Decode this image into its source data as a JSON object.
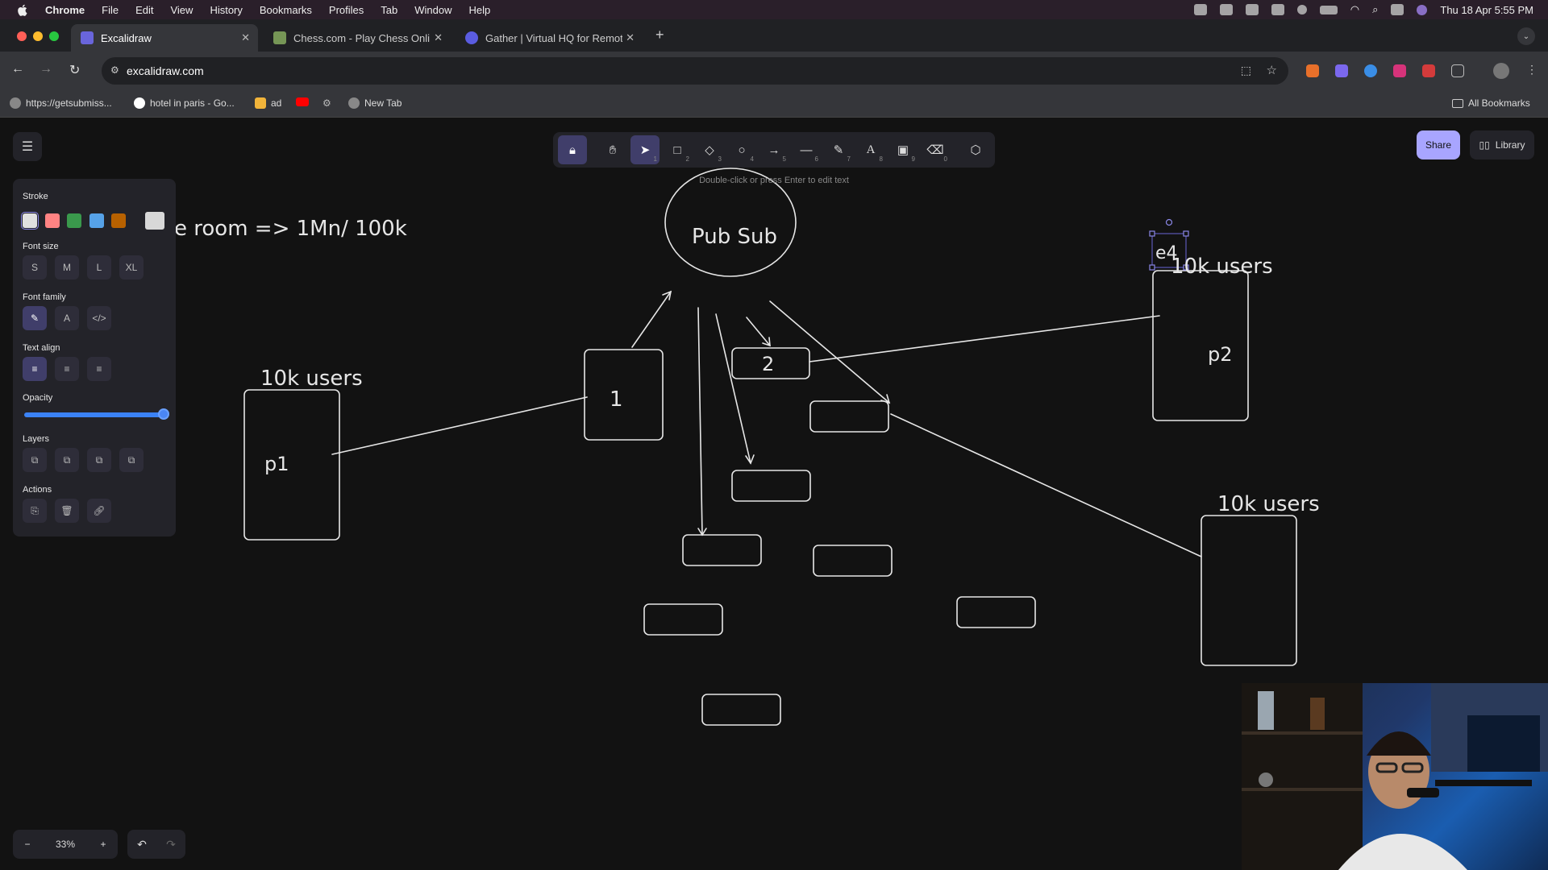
{
  "menubar": {
    "app": "Chrome",
    "items": [
      "File",
      "Edit",
      "View",
      "History",
      "Bookmarks",
      "Profiles",
      "Tab",
      "Window",
      "Help"
    ],
    "clock": "Thu 18 Apr  5:55 PM"
  },
  "tabs": [
    {
      "label": "Excalidraw",
      "icon": "excalidraw-icon",
      "active": true
    },
    {
      "label": "Chess.com - Play Chess Onli",
      "icon": "chess-icon",
      "active": false
    },
    {
      "label": "Gather | Virtual HQ for Remot",
      "icon": "gather-icon",
      "active": false
    }
  ],
  "address": {
    "url": "excalidraw.com"
  },
  "bookmarks": {
    "items": [
      "https://getsubmiss...",
      "hotel in paris - Go...",
      "ad",
      "",
      "",
      "New Tab"
    ],
    "all": "All Bookmarks"
  },
  "excalidraw": {
    "hint": "Double-click or press Enter to edit text",
    "share": "Share",
    "library": "Library",
    "tools": [
      {
        "name": "lock",
        "key": ""
      },
      {
        "name": "hand",
        "key": ""
      },
      {
        "name": "selection",
        "key": "1"
      },
      {
        "name": "rectangle",
        "key": "2"
      },
      {
        "name": "diamond",
        "key": "3"
      },
      {
        "name": "ellipse",
        "key": "4"
      },
      {
        "name": "arrow",
        "key": "5"
      },
      {
        "name": "line",
        "key": "6"
      },
      {
        "name": "draw",
        "key": "7"
      },
      {
        "name": "text",
        "key": "8"
      },
      {
        "name": "image",
        "key": "9"
      },
      {
        "name": "eraser",
        "key": "0"
      },
      {
        "name": "more-tools",
        "key": ""
      }
    ],
    "props": {
      "stroke_label": "Stroke",
      "stroke_colors": [
        "#e0e0e0",
        "#ff8383",
        "#3a994c",
        "#56a2e8",
        "#b76100"
      ],
      "stroke_current": "#d8d8d8",
      "font_size_label": "Font size",
      "font_sizes": [
        "S",
        "M",
        "L",
        "XL"
      ],
      "font_family_label": "Font family",
      "text_align_label": "Text align",
      "opacity_label": "Opacity",
      "opacity_value": 100,
      "layers_label": "Layers",
      "actions_label": "Actions"
    },
    "zoom": "33%"
  },
  "canvas_text": {
    "room": "e room => 1Mn/ 100k",
    "pubsub": "Pub Sub",
    "node1": "1",
    "node2": "2",
    "users_p1": "10k users",
    "p1": "p1",
    "users_p2": "10k users",
    "p2": "p2",
    "selected": "e4",
    "users_p3": "10k users"
  }
}
